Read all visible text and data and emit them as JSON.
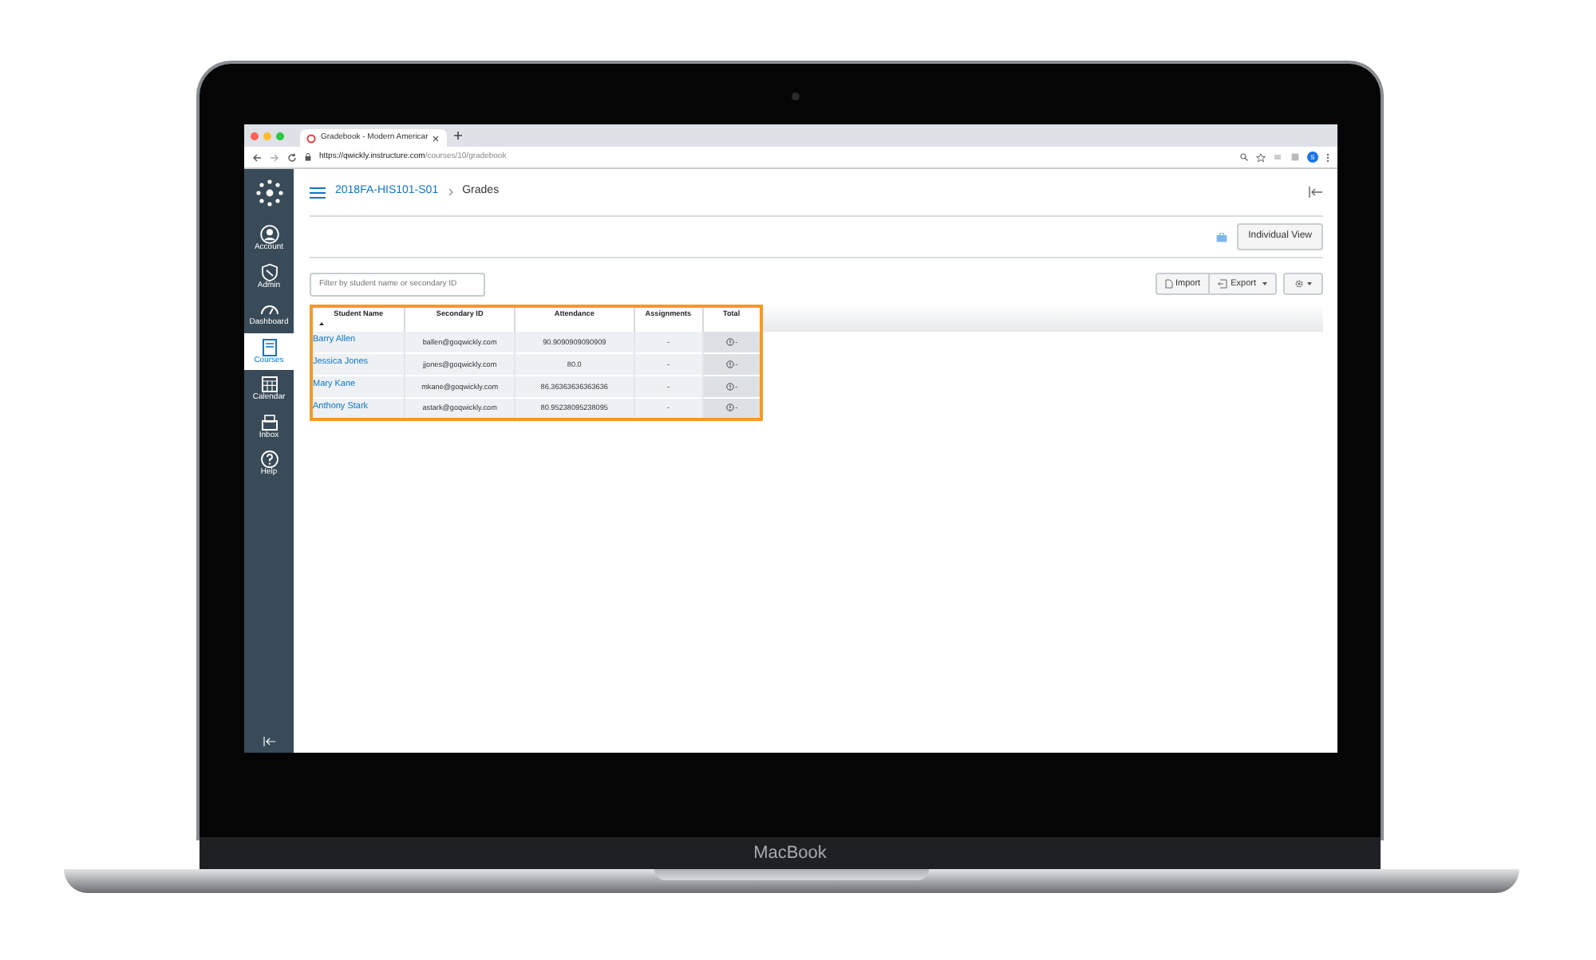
{
  "browser": {
    "tab_title": "Gradebook - Modern Americar",
    "url_host": "https://qwickly.instructure.com",
    "url_path": "/courses/10/gradebook",
    "profile_letter": "S"
  },
  "sidebar": {
    "items": [
      {
        "label": "Account",
        "kind": "account",
        "selected": false
      },
      {
        "label": "Admin",
        "kind": "admin",
        "selected": false
      },
      {
        "label": "Dashboard",
        "kind": "dashboard",
        "selected": false
      },
      {
        "label": "Courses",
        "kind": "courses",
        "selected": true
      },
      {
        "label": "Calendar",
        "kind": "calendar",
        "selected": false
      },
      {
        "label": "Inbox",
        "kind": "inbox",
        "selected": false
      },
      {
        "label": "Help",
        "kind": "help",
        "selected": false
      }
    ]
  },
  "breadcrumb": {
    "course": "2018FA-HIS101-S01",
    "page": "Grades"
  },
  "individual_view_button": "Individual View",
  "filter": {
    "placeholder": "Filter by student name or secondary ID"
  },
  "toolbar": {
    "import": "Import",
    "export": "Export"
  },
  "table": {
    "columns": [
      "Student Name",
      "Secondary ID",
      "Attendance",
      "Assignments",
      "Total"
    ],
    "rows": [
      {
        "name": "Barry Allen",
        "secondary_id": "ballen@goqwickly.com",
        "attendance": "90.9090909090909",
        "assignments": "-",
        "total": "-"
      },
      {
        "name": "Jessica Jones",
        "secondary_id": "jjones@goqwickly.com",
        "attendance": "80.0",
        "assignments": "-",
        "total": "-"
      },
      {
        "name": "Mary Kane",
        "secondary_id": "mkane@goqwickly.com",
        "attendance": "86.36363636363636",
        "assignments": "-",
        "total": "-"
      },
      {
        "name": "Anthony Stark",
        "secondary_id": "astark@goqwickly.com",
        "attendance": "80.95238095238095",
        "assignments": "-",
        "total": "-"
      }
    ]
  },
  "laptop": {
    "brand": "MacBook"
  }
}
